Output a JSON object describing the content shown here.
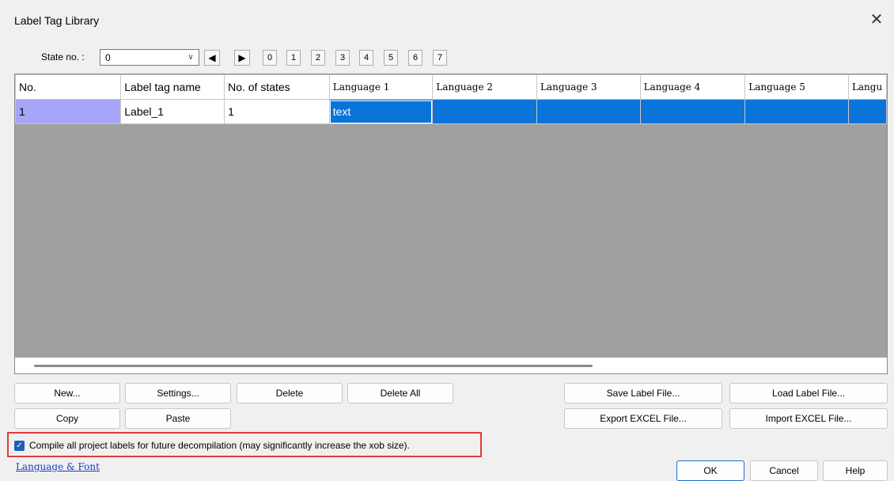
{
  "window": {
    "title": "Label Tag Library",
    "close_glyph": "✕"
  },
  "state": {
    "label": "State no. :",
    "value": "0",
    "prev_glyph": "◀",
    "next_glyph": "▶",
    "numbers": [
      "0",
      "1",
      "2",
      "3",
      "4",
      "5",
      "6",
      "7"
    ]
  },
  "grid": {
    "columns": [
      "No.",
      "Label tag name",
      "No. of states",
      "Language 1",
      "Language 2",
      "Language 3",
      "Language 4",
      "Language 5",
      "Langu"
    ],
    "rows": [
      [
        "1",
        "Label_1",
        "1",
        "text",
        "",
        "",
        "",
        "",
        ""
      ]
    ]
  },
  "buttons": {
    "new": "New...",
    "settings": "Settings...",
    "delete": "Delete",
    "delete_all": "Delete All",
    "copy": "Copy",
    "paste": "Paste",
    "save_label": "Save Label File...",
    "load_label": "Load Label File...",
    "export_excel": "Export EXCEL File...",
    "import_excel": "Import EXCEL File...",
    "ok": "OK",
    "cancel": "Cancel",
    "help": "Help"
  },
  "compile": {
    "checked": true,
    "check_glyph": "✓",
    "label": "Compile all project labels for future decompilation (may significantly increase the xob size)."
  },
  "link": {
    "label": "Language & Font"
  },
  "colors": {
    "selection": "#0a74d9",
    "row_header_selected": "#a8a4f7",
    "grid_empty": "#a0a0a0",
    "highlight_border": "#e23a3a",
    "link": "#1a3ec0"
  }
}
